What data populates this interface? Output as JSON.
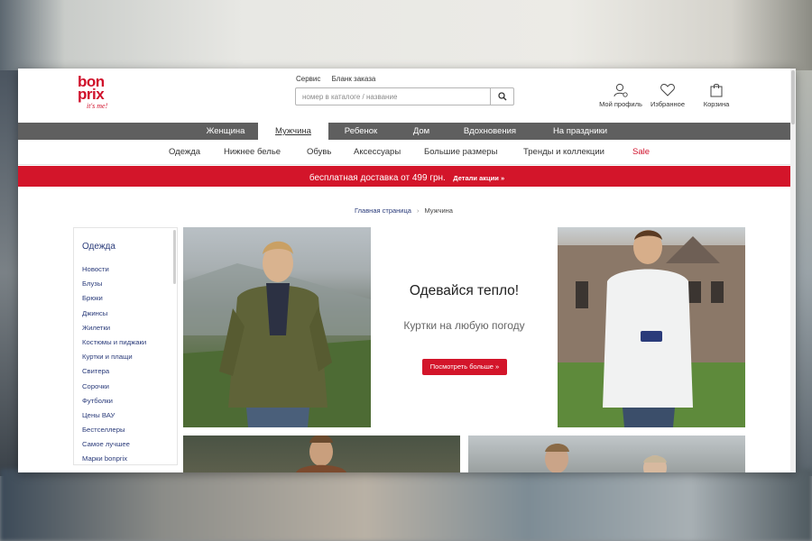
{
  "header": {
    "logo": {
      "line1": "bon",
      "line2": "prix",
      "tagline": "it's me!"
    },
    "service_links": [
      "Сервис",
      "Бланк заказа"
    ],
    "search": {
      "placeholder": "номер в каталоге / название"
    },
    "icons": [
      {
        "label": "Мой профиль",
        "icon": "user-icon"
      },
      {
        "label": "Избранное",
        "icon": "heart-icon"
      },
      {
        "label": "Корзина",
        "icon": "bag-icon"
      }
    ]
  },
  "main_nav": {
    "items": [
      "Женщина",
      "Мужчина",
      "Ребенок",
      "Дом",
      "Вдохновения",
      "На праздники"
    ],
    "active": "Мужчина"
  },
  "sub_nav": {
    "items": [
      "Одежда",
      "Нижнее белье",
      "Обувь",
      "Аксессуары",
      "Большие размеры",
      "Тренды и коллекции",
      "Sale"
    ]
  },
  "promo": {
    "text": "бесплатная доставка от 499 грн.",
    "link": "Детали акции »"
  },
  "breadcrumb": {
    "home": "Главная страница",
    "current": "Мужчина"
  },
  "sidebar": {
    "title": "Одежда",
    "items": [
      "Новости",
      "Блузы",
      "Брюки",
      "Джинсы",
      "Жилетки",
      "Костюмы и пиджаки",
      "Куртки и плащи",
      "Свитера",
      "Сорочки",
      "Футболки",
      "Цены ВАУ",
      "Бестселлеры",
      "Самое лучшее",
      "Марки bonprix"
    ]
  },
  "hero": {
    "title": "Одевайся тепло!",
    "subtitle": "Куртки на любую погоду",
    "cta": "Посмотреть больше »"
  },
  "colors": {
    "brand_red": "#d3152a",
    "nav_gray": "#5f5f5f",
    "link_blue": "#2a3b7a"
  }
}
